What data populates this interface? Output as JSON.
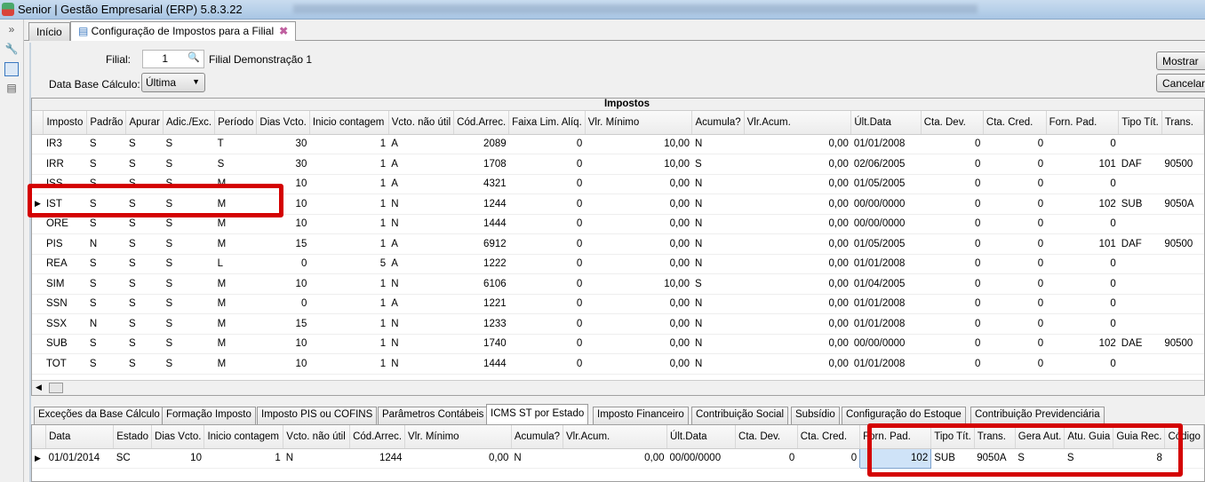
{
  "window": {
    "title": "Senior | Gestão Empresarial (ERP) 5.8.3.22"
  },
  "tabs": [
    {
      "label": "Início"
    },
    {
      "label": "Configuração de Impostos para a Filial"
    }
  ],
  "form": {
    "filial_label": "Filial:",
    "filial_value": "1",
    "filial_name": "Filial Demonstração 1",
    "data_base_label": "Data Base Cálculo:",
    "data_base_value": "Última",
    "mostrar": "Mostrar",
    "cancelar": "Cancelar"
  },
  "impostos": {
    "title": "Impostos",
    "columns": [
      "Imposto",
      "Padrão",
      "Apurar",
      "Adic./Exc.",
      "Período",
      "Dias Vcto.",
      "Inicio contagem",
      "Vcto. não útil",
      "Cód.Arrec.",
      "Faixa Lim. Alíq.",
      "Vlr. Mínimo",
      "Acumula?",
      "Vlr.Acum.",
      "Últ.Data",
      "Cta. Dev.",
      "Cta. Cred.",
      "Forn. Pad.",
      "Tipo Tít.",
      "Trans."
    ],
    "rows": [
      [
        "IR3",
        "S",
        "S",
        "S",
        "T",
        "30",
        "1",
        "A",
        "2089",
        "0",
        "10,00",
        "N",
        "0,00",
        "01/01/2008",
        "0",
        "0",
        "0",
        "",
        ""
      ],
      [
        "IRR",
        "S",
        "S",
        "S",
        "S",
        "30",
        "1",
        "A",
        "1708",
        "0",
        "10,00",
        "S",
        "0,00",
        "02/06/2005",
        "0",
        "0",
        "101",
        "DAF",
        "90500"
      ],
      [
        "ISS",
        "S",
        "S",
        "S",
        "M",
        "10",
        "1",
        "A",
        "4321",
        "0",
        "0,00",
        "N",
        "0,00",
        "01/05/2005",
        "0",
        "0",
        "0",
        "",
        ""
      ],
      [
        "IST",
        "S",
        "S",
        "S",
        "M",
        "10",
        "1",
        "N",
        "1244",
        "0",
        "0,00",
        "N",
        "0,00",
        "00/00/0000",
        "0",
        "0",
        "102",
        "SUB",
        "9050A"
      ],
      [
        "ORE",
        "S",
        "S",
        "S",
        "M",
        "10",
        "1",
        "N",
        "1444",
        "0",
        "0,00",
        "N",
        "0,00",
        "00/00/0000",
        "0",
        "0",
        "0",
        "",
        ""
      ],
      [
        "PIS",
        "N",
        "S",
        "S",
        "M",
        "15",
        "1",
        "A",
        "6912",
        "0",
        "0,00",
        "N",
        "0,00",
        "01/05/2005",
        "0",
        "0",
        "101",
        "DAF",
        "90500"
      ],
      [
        "REA",
        "S",
        "S",
        "S",
        "L",
        "0",
        "5",
        "A",
        "1222",
        "0",
        "0,00",
        "N",
        "0,00",
        "01/01/2008",
        "0",
        "0",
        "0",
        "",
        ""
      ],
      [
        "SIM",
        "S",
        "S",
        "S",
        "M",
        "10",
        "1",
        "N",
        "6106",
        "0",
        "10,00",
        "S",
        "0,00",
        "01/04/2005",
        "0",
        "0",
        "0",
        "",
        ""
      ],
      [
        "SSN",
        "S",
        "S",
        "S",
        "M",
        "0",
        "1",
        "A",
        "1221",
        "0",
        "0,00",
        "N",
        "0,00",
        "01/01/2008",
        "0",
        "0",
        "0",
        "",
        ""
      ],
      [
        "SSX",
        "N",
        "S",
        "S",
        "M",
        "15",
        "1",
        "N",
        "1233",
        "0",
        "0,00",
        "N",
        "0,00",
        "01/01/2008",
        "0",
        "0",
        "0",
        "",
        ""
      ],
      [
        "SUB",
        "S",
        "S",
        "S",
        "M",
        "10",
        "1",
        "N",
        "1740",
        "0",
        "0,00",
        "N",
        "0,00",
        "00/00/0000",
        "0",
        "0",
        "102",
        "DAE",
        "90500"
      ],
      [
        "TOT",
        "S",
        "S",
        "S",
        "M",
        "10",
        "1",
        "N",
        "1444",
        "0",
        "0,00",
        "N",
        "0,00",
        "01/01/2008",
        "0",
        "0",
        "0",
        "",
        ""
      ]
    ]
  },
  "bottom_tabs": [
    "Exceções da Base Cálculo",
    "Formação Imposto",
    "Imposto PIS ou COFINS",
    "Parâmetros Contábeis",
    "ICMS ST por Estado",
    "Imposto Financeiro",
    "Contribuição Social",
    "Subsídio",
    "Configuração do Estoque",
    "Contribuição Previdenciária"
  ],
  "icms": {
    "columns": [
      "Data",
      "Estado",
      "Dias Vcto.",
      "Inicio contagem",
      "Vcto. não útil",
      "Cód.Arrec.",
      "Vlr. Mínimo",
      "Acumula?",
      "Vlr.Acum.",
      "Últ.Data",
      "Cta. Dev.",
      "Cta. Cred.",
      "Forn. Pad.",
      "Tipo Tít.",
      "Trans.",
      "Gera Aut.",
      "Atu. Guia",
      "Guia Rec.",
      "Código"
    ],
    "rows": [
      [
        "01/01/2014",
        "SC",
        "10",
        "1",
        "N",
        "1244",
        "0,00",
        "N",
        "0,00",
        "00/00/0000",
        "0",
        "0",
        "102",
        "SUB",
        "9050A",
        "S",
        "S",
        "8",
        ""
      ]
    ]
  }
}
